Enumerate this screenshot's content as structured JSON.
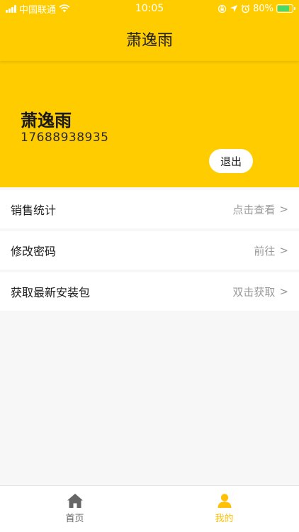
{
  "status_bar": {
    "carrier": "中国联通",
    "time": "10:05",
    "battery_percent": "80%",
    "battery_level": 0.8
  },
  "navbar": {
    "title": "萧逸雨"
  },
  "profile": {
    "name": "萧逸雨",
    "phone": "17688938935",
    "logout_label": "退出"
  },
  "menu": {
    "items": [
      {
        "label": "销售统计",
        "action": "点击查看"
      },
      {
        "label": "修改密码",
        "action": "前往"
      },
      {
        "label": "获取最新安装包",
        "action": "双击获取"
      }
    ]
  },
  "tabbar": {
    "tabs": [
      {
        "label": "首页",
        "icon": "home-icon",
        "active": false
      },
      {
        "label": "我的",
        "icon": "user-icon",
        "active": true
      }
    ]
  },
  "colors": {
    "brand": "#FFCC00",
    "inactive_tab": "#666666",
    "active_tab": "#FFC107",
    "muted_text": "#999999"
  }
}
